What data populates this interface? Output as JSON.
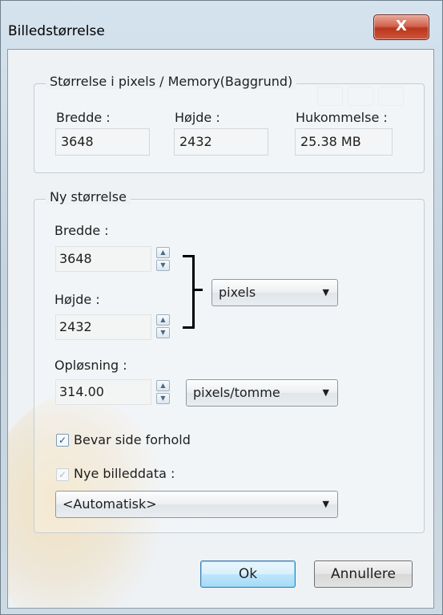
{
  "window": {
    "title": "Billedstørrelse",
    "close_glyph": "X"
  },
  "size_group": {
    "legend": "Størrelse i pixels / Memory(Baggrund)",
    "width_label": "Bredde :",
    "height_label": "Højde :",
    "memory_label": "Hukommelse :",
    "width_value": "3648",
    "height_value": "2432",
    "memory_value": "25.38 MB"
  },
  "new_size_group": {
    "legend": "Ny størrelse",
    "width_label": "Bredde :",
    "width_value": "3648",
    "height_label": "Højde :",
    "height_value": "2432",
    "unit_select": "pixels",
    "resolution_label": "Opløsning :",
    "resolution_value": "314.00",
    "resolution_unit_select": "pixels/tomme",
    "keep_ratio_label": "Bevar side forhold",
    "keep_ratio_checked": true,
    "new_data_label": "Nye billeddata :",
    "new_data_checked": true,
    "new_data_select": "<Automatisk>"
  },
  "buttons": {
    "ok": "Ok",
    "cancel": "Annullere"
  },
  "icons": {
    "up": "up-arrow-icon",
    "down": "down-arrow-icon",
    "dropdown": "chevron-down-icon",
    "check": "check-icon"
  }
}
